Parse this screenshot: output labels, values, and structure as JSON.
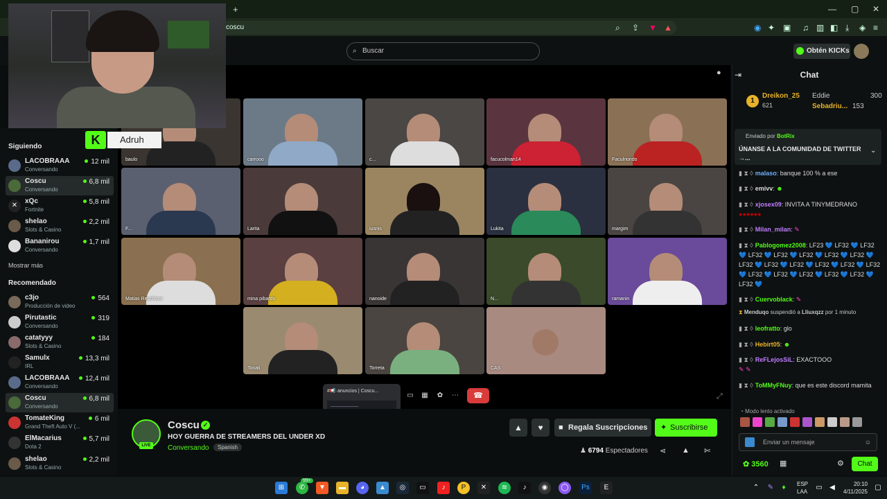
{
  "browser": {
    "url": "coscu",
    "new_tab": "+",
    "window_controls": [
      "—",
      "▢",
      "✕"
    ]
  },
  "site": {
    "search_placeholder": "Buscar",
    "kicks_label": "Obtén KICKs"
  },
  "webcam_overlay": {
    "name": "Adruh",
    "logo_letter": "K"
  },
  "sidebar": {
    "following_header": "Siguiendo",
    "following": [
      {
        "name": "LACOBRAAA",
        "sub": "Conversando",
        "viewers": "12 mil"
      },
      {
        "name": "Coscu",
        "sub": "Conversando",
        "viewers": "6,8 mil",
        "active": true
      },
      {
        "name": "xQc",
        "sub": "Fortnite",
        "viewers": "5,8 mil"
      },
      {
        "name": "shelao",
        "sub": "Slots & Casino",
        "viewers": "2,2 mil"
      },
      {
        "name": "Bananirou",
        "sub": "Conversando",
        "viewers": "1,7 mil"
      }
    ],
    "show_more": "Mostrar más",
    "recommended_header": "Recomendado",
    "recommended": [
      {
        "name": "c3jo",
        "sub": "Producción de video",
        "viewers": "564"
      },
      {
        "name": "Pirutastic",
        "sub": "Conversando",
        "viewers": "319"
      },
      {
        "name": "catatyyy",
        "sub": "Slots & Casino",
        "viewers": "184"
      },
      {
        "name": "Samulx",
        "sub": "IRL",
        "viewers": "13,3 mil"
      },
      {
        "name": "LACOBRAAA",
        "sub": "Conversando",
        "viewers": "12,4 mil"
      },
      {
        "name": "Coscu",
        "sub": "Conversando",
        "viewers": "6,8 mil",
        "active": true
      },
      {
        "name": "TomateKing",
        "sub": "Grand Theft Auto V (...",
        "viewers": "6 mil"
      },
      {
        "name": "ElMacarius",
        "sub": "Dota 2",
        "viewers": "5,7 mil"
      },
      {
        "name": "shelao",
        "sub": "Slots & Casino",
        "viewers": "2,2 mil"
      }
    ]
  },
  "call_tiles": [
    "baulo",
    "carrooo",
    "c...",
    "facucolman14",
    "Faculriondo",
    "F...",
    "Larita",
    "iusnis",
    "Lukita",
    "margim",
    "Matias Recchioni",
    "mina pibardo",
    "nanoide",
    "N...",
    "ramanin",
    "Tonali",
    "Torreta",
    "CAS"
  ],
  "popup": {
    "title": "#📢·anuncios | Coscu..."
  },
  "channel": {
    "name": "Coscu",
    "live": "LIVE",
    "title": "HOY GUERRA DE STREAMERS DEL UNDER XD",
    "category": "Conversando",
    "language": "Spanish",
    "gift_label": "Regala Suscripciones",
    "subscribe_label": "Suscribirse",
    "viewers": "6794",
    "viewers_label": "Espectadores"
  },
  "chat": {
    "header": "Chat",
    "leaderboard": [
      {
        "name": "Dreikon_25",
        "value": "621"
      },
      {
        "name": "Eddie",
        "value": "300"
      },
      {
        "name": "Sebadriu...",
        "value": "153"
      }
    ],
    "pinned_by": "Enviado por",
    "pinned_user": "BotRix",
    "pinned_text": "ÚNANSE A LA COMUNIDAD DE TWITTER →...",
    "messages": [
      {
        "user": "malaso",
        "text": "banque 100 % a ese",
        "color": "#6fb0ff"
      },
      {
        "user": "emivv",
        "text": "",
        "color": "#e8e8e8"
      },
      {
        "user": "xjosex09",
        "text": "INVITA A TINYMEDRANO",
        "color": "#c07cff"
      },
      {
        "user": "Milan_milan",
        "text": "",
        "color": "#c07cff"
      },
      {
        "user": "Pablogomez2008",
        "text": "LF23 💙 LF32 💙 LF32 💙 LF32 💙 LF32 💙 LF32 💙 LF32 💙 LF32 💙 LF32 💙 LF32 💙 LF32 💙 LF32 💙 LF32 💙 LF32 💙 LF32 💙 LF32 💙 LF32 💙 LF32 💙 LF32 💙 LF32 💙",
        "color": "#53fc18"
      },
      {
        "user": "Cuervoblack",
        "text": "",
        "color": "#53fc18"
      },
      {
        "user": "leofratto",
        "text": "glo",
        "color": "#53fc18"
      },
      {
        "user": "Hebirt05",
        "text": "",
        "color": "#e8b32a"
      },
      {
        "user": "ReFLejosSiL",
        "text": "EXACTOOO",
        "color": "#c07cff"
      },
      {
        "user": "ToMMyFNuy",
        "text": "que es este discord mamita",
        "color": "#53fc18"
      }
    ],
    "system": {
      "mod": "Menduqo",
      "action": "suspendió a",
      "target": "Lliuxqzz",
      "duration": "por 1 minuto"
    },
    "slow_mode": "Modo lento activado",
    "input_placeholder": "Enviar un mensaje",
    "points": "3560",
    "send_label": "Chat"
  },
  "taskbar": {
    "lang": "ESP",
    "lang2": "LAA",
    "time": "20:10",
    "date": "4/11/2025",
    "badge": "99+"
  },
  "colors": {
    "accent": "#53fc18",
    "bg": "#0b0e0f"
  }
}
